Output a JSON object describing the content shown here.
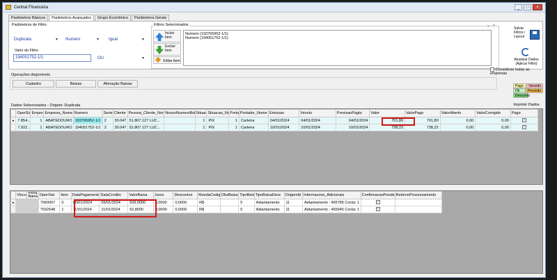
{
  "window": {
    "title": "Central Financeira",
    "buttons": [
      "_",
      "□",
      "×"
    ]
  },
  "tabs": [
    "Parâmetros Básicos",
    "Parâmetros Avançados",
    "Grupo Econômico",
    "Parâmetros Gerais"
  ],
  "filter": {
    "section_label": "Parâmetros de Filtro",
    "field1": "Duplicata",
    "field2": "Numero",
    "operator": "Igual",
    "value_label": "Valor do Filtro",
    "value": "194051752-1/1",
    "connector": "OU",
    "selected_label": "Filtros Selecionados",
    "selected_items": [
      "Numero (193765952-1/1)",
      "Numero (194051752-1/1)"
    ],
    "include_label": "Incluir Item",
    "exclude_label": "Excluir Item",
    "edit_label": "Editar Item"
  },
  "right_actions": {
    "save_label": "Salvar Filtros / Layout",
    "refresh_label": "Atualizar Dados (Aplicar Filtro)",
    "consider_all": "Considerar todas as empresas"
  },
  "operations": {
    "label": "Operações disponíveis",
    "buttons": [
      "Cadastro",
      "Baixas",
      "Alteração Baixas"
    ]
  },
  "legend": {
    "items": [
      {
        "label": "Pago",
        "color": "#f4f4a0"
      },
      {
        "label": "Vencido",
        "color": "#f7b9b9"
      },
      {
        "label": "Ok",
        "color": "#b9f0b9"
      },
      {
        "label": "Previsão",
        "color": "#f5b94a"
      },
      {
        "label": "Desconto",
        "color": "#79d879"
      }
    ],
    "print_label": "Imprimir Dados"
  },
  "main_grid": {
    "caption": "Dados Selecionados - Origem: Duplicata",
    "columns": [
      "OperSis",
      "Empresa",
      "Empresa_Nome",
      "Numero",
      "Serie",
      "Cliente",
      "Pessoa_Cliente_Nome",
      "NossoNumeroBole",
      "Situacao",
      "Situacao_Nome",
      "Portador",
      "Portador_Nome",
      "Emissao",
      "Vencto",
      "PrevisaoPagto",
      "Valor",
      "ValorPago",
      "ValorAberto",
      "ValorCorrigido",
      "Pago"
    ],
    "rows": [
      [
        "7.854...",
        "1",
        "ABATEDOURO ...",
        "193765952-1/1",
        "2",
        "30.047",
        "51.807.127 LUC...",
        "",
        "1",
        "PIX",
        "1",
        "Carteira",
        "04/01/2024",
        "04/01/2024",
        "04/01/2024",
        "701,80",
        "701,80",
        "0,00",
        "0,00",
        "✓"
      ],
      [
        "7.922...",
        "1",
        "ABATEDOURO ...",
        "194051752-1/1",
        "2",
        "30.047",
        "51.807.127 LUC...",
        "",
        "1",
        "PIX",
        "1",
        "Carteira",
        "10/01/2024",
        "10/01/2024",
        "10/01/2024",
        "738,22",
        "738,22",
        "0,00",
        "0,00",
        "✓"
      ]
    ]
  },
  "sub_grid": {
    "columns": [
      "Vinculo",
      "Pesq. Baixa",
      "OperSist",
      "Item",
      "DataPagamento",
      "DataCredito",
      "ValorBaixa",
      "Juros",
      "Descontos",
      "MoedaCodigo",
      "ObsBaixa",
      "TipoBaixa",
      "TipoBaixaDesc",
      "OrigemId",
      "Informacoes_Adicionais",
      "ConfirmacaoPendente",
      "RetornoProcessamento"
    ],
    "rows": [
      [
        "",
        "",
        "7060007",
        "0",
        "05/01/2024",
        "05/01/2024",
        "639,0000",
        "0,0000",
        "0,0000",
        "R$",
        "",
        "5",
        "Adiantamento",
        "11",
        "Adiantamento : 465785 Conta: 1 1",
        "✓",
        ""
      ],
      [
        "",
        "",
        "7932648",
        "1",
        "11/01/2024",
        "11/01/2024",
        "62,8000",
        "0,0000",
        "0,0000",
        "R$",
        "",
        "5",
        "Adiantamento",
        "11",
        "Adiantamento : 465945 Conta: 1 1",
        "✓",
        ""
      ]
    ]
  }
}
